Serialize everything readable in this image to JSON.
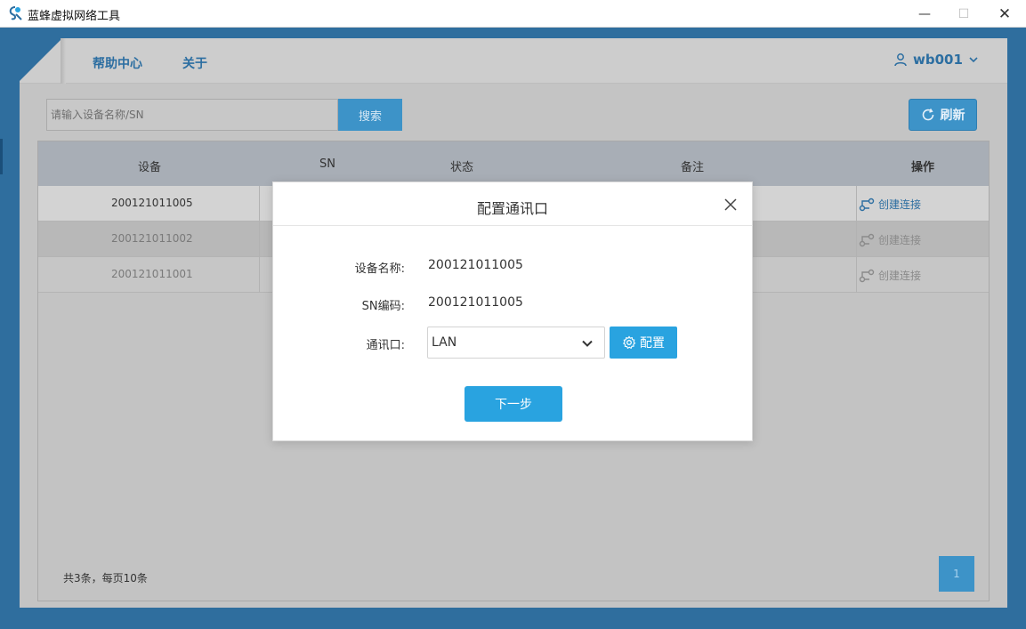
{
  "window": {
    "title": "蓝蜂虚拟网络工具",
    "minimize": "—",
    "maximize": "☐",
    "close": "✕"
  },
  "nav": {
    "help": "帮助中心",
    "about": "关于",
    "user": "wb001"
  },
  "search": {
    "placeholder": "请输入设备名称/SN",
    "button": "搜索"
  },
  "refresh_label": "刷新",
  "table": {
    "headers": [
      "设备",
      "SN",
      "状态",
      "备注",
      "操作"
    ],
    "rows": [
      {
        "device": "200121011005",
        "action": "创建连接"
      },
      {
        "device": "200121011002",
        "action": "创建连接"
      },
      {
        "device": "200121011001",
        "action": "创建连接"
      }
    ]
  },
  "pager": {
    "info": "共3条，每页10条",
    "page": "1"
  },
  "dialog": {
    "title": "配置通讯口",
    "name_label": "设备名称:",
    "name_value": "200121011005",
    "sn_label": "SN编码:",
    "sn_value": "200121011005",
    "port_label": "通讯口:",
    "port_value": "LAN",
    "config_button": "配置",
    "next_button": "下一步"
  },
  "colors": {
    "accent": "#29a3e0",
    "link": "#2c6ea1",
    "app_background": "#2f6e9e"
  }
}
